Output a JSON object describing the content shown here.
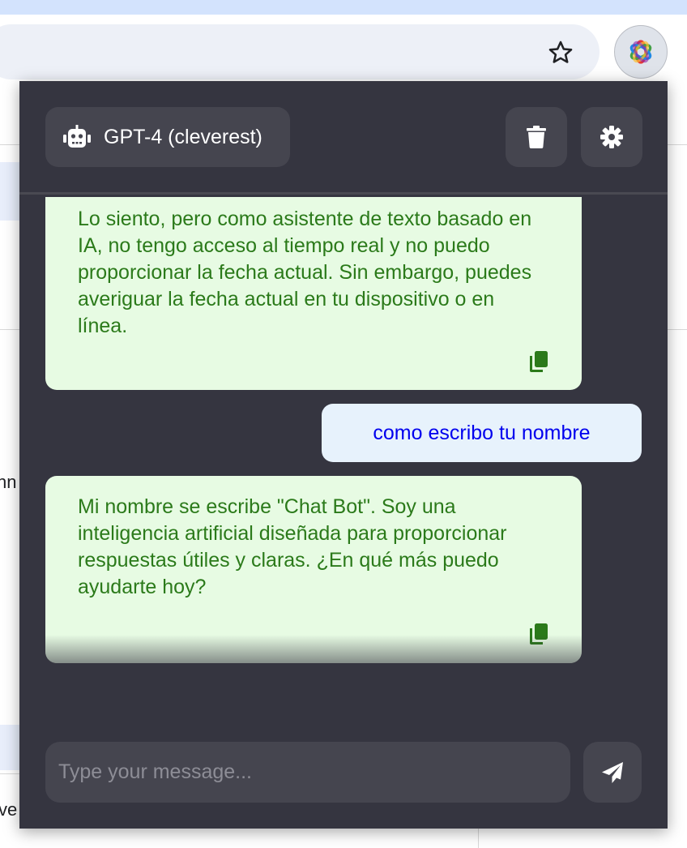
{
  "header": {
    "model_label": "GPT-4 (cleverest)"
  },
  "messages": [
    {
      "role": "assistant",
      "text": "Lo siento, pero como asistente de texto basado en IA, no tengo acceso al tiempo real y no puedo proporcionar la fecha actual. Sin embargo, puedes averiguar la fecha actual en tu dispositivo o en línea."
    },
    {
      "role": "user",
      "text": "como escribo tu nombre"
    },
    {
      "role": "assistant",
      "text": "Mi nombre se escribe \"Chat Bot\". Soy una inteligencia artificial diseñada para proporcionar respuestas útiles y claras. ¿En qué más puedo ayudarte hoy?"
    }
  ],
  "composer": {
    "placeholder": "Type your message..."
  },
  "background": {
    "fragment_1": "nn",
    "fragment_2": "ve"
  },
  "icons": {
    "model": "robot-icon",
    "clear": "trash-icon",
    "settings": "gear-icon",
    "copy": "copy-icon",
    "send": "paper-plane-icon",
    "bookmark": "star-icon",
    "extension": "openai-logo-icon"
  },
  "colors": {
    "popup_bg": "#353540",
    "button_bg": "#45454f",
    "bot_bubble_bg": "#e7fbe3",
    "bot_text": "#2b7a1a",
    "user_bubble_bg": "#e7f2fc",
    "user_text": "#0000ee"
  }
}
